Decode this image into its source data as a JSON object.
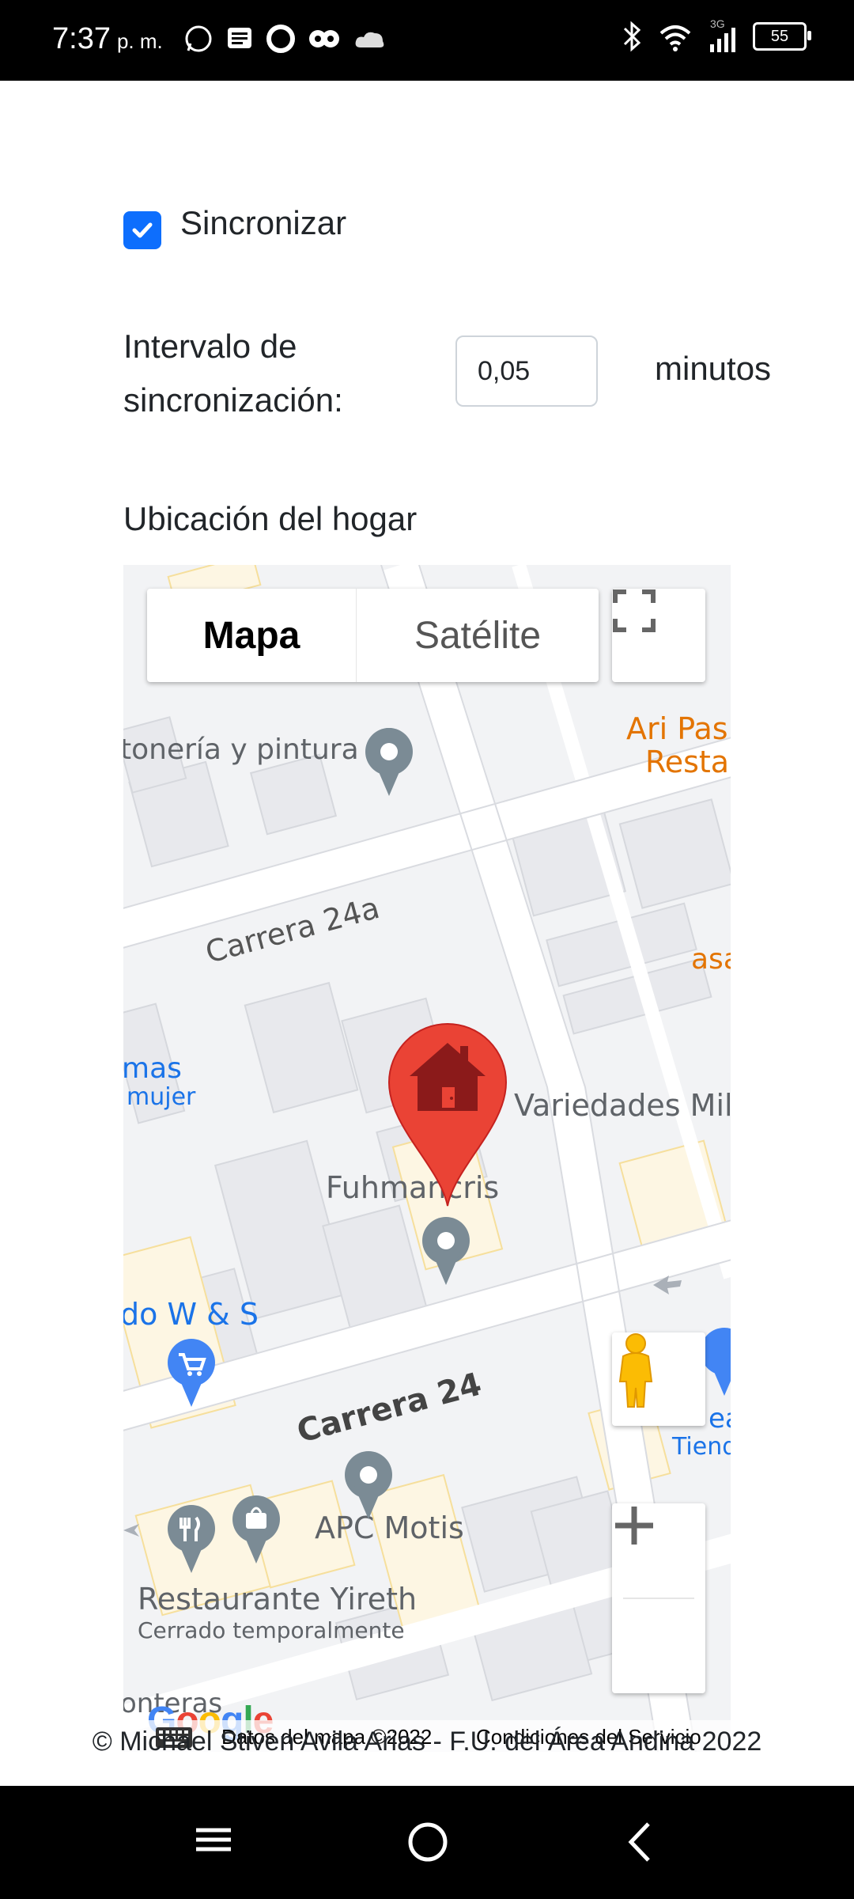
{
  "status_bar": {
    "time": "7:37",
    "ampm": "p. m.",
    "network": "3G",
    "battery": "55"
  },
  "form": {
    "sync_label": "Sincronizar",
    "sync_checked": true,
    "interval_label": "Intervalo de sincronización:",
    "interval_value": "0,05",
    "interval_unit": "minutos",
    "home_location_label": "Ubicación del hogar"
  },
  "map": {
    "type_map": "Mapa",
    "type_satellite": "Satélite",
    "streets": [
      "Carrera 24a",
      "Carrera 24"
    ],
    "places": {
      "p1": "tonería y pintura",
      "p2a": "Ari Pas",
      "p2b": "Resta",
      "p3": "asa",
      "p4a": "mas",
      "p4b": "mujer",
      "p5": "Variedades Mil",
      "p6": "Fuhmancris",
      "p7": "do W & S",
      "p8a": "ea",
      "p8b": "Tiend",
      "p9": "APC Motis",
      "p10": "Restaurante Yireth",
      "p11": "Cerrado temporalmente",
      "p12": "onteras"
    },
    "footer_data": "Datos del mapa ©2022",
    "footer_terms": "Condiciones del Servicio",
    "google_logo": "Google"
  },
  "footer": {
    "copyright": "© Michael Stiven Avila Arias - F.U. del Área Andina 2022"
  },
  "colors": {
    "accent": "#0d6efd",
    "marker": "#ea4335",
    "poi_orange": "#e37400"
  }
}
